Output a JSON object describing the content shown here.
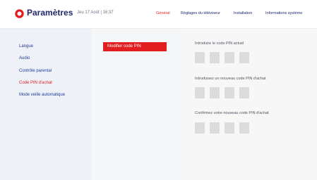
{
  "header": {
    "title": "Paramètres",
    "datetime": "Jeu 17 Août | 16:37",
    "logo_icon": "orange-ring-logo",
    "accent_color": "#e11d1d"
  },
  "tabs": [
    {
      "label": "Général",
      "active": true
    },
    {
      "label": "Réglages du téléviseur",
      "active": false
    },
    {
      "label": "Installation",
      "active": false
    },
    {
      "label": "Informations système",
      "active": false
    }
  ],
  "sidebar": {
    "items": [
      {
        "label": "Langue",
        "active": false
      },
      {
        "label": "Audio",
        "active": false
      },
      {
        "label": "Contrôle parental",
        "active": false
      },
      {
        "label": "Code PIN d'achat",
        "active": true
      },
      {
        "label": "Mode veille automatique",
        "active": false
      }
    ]
  },
  "middle": {
    "button_label": "Modifier code PIN"
  },
  "pin_sections": [
    {
      "label": "Introduire le code PIN actuel"
    },
    {
      "label": "Introduisez un nouveau code PIN d'achat"
    },
    {
      "label": "Confirmez votre nouveau code PIN d'achat"
    }
  ]
}
